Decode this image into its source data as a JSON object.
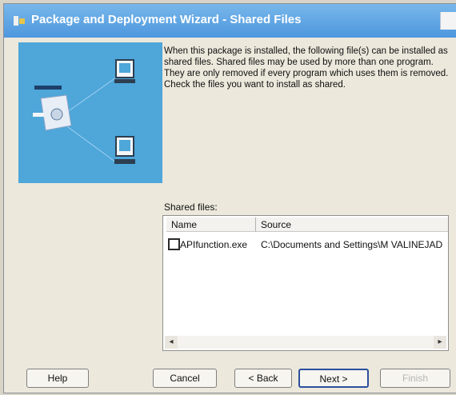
{
  "window": {
    "title": "Package and Deployment Wizard - Shared Files"
  },
  "description": "When this package is installed, the following file(s) can be installed as shared files. Shared files may be used by more than one program. They are only removed if every program which uses them is removed. Check the files you want to install as shared.",
  "shared_files": {
    "label": "Shared files:",
    "columns": [
      "Name",
      "Source"
    ],
    "rows": [
      {
        "checked": false,
        "name": "APIfunction.exe",
        "source": "C:\\Documents and Settings\\M VALINEJAD"
      }
    ]
  },
  "buttons": {
    "help": "Help",
    "cancel": "Cancel",
    "back": "< Back",
    "next": "Next >",
    "finish": "Finish"
  },
  "colors": {
    "titlebar": "#4e97de",
    "image_background": "#4ea6d9"
  },
  "icons": [
    "app-icon",
    "close-icon",
    "computer-icon",
    "package-icon",
    "scroll-left-icon",
    "scroll-right-icon"
  ]
}
